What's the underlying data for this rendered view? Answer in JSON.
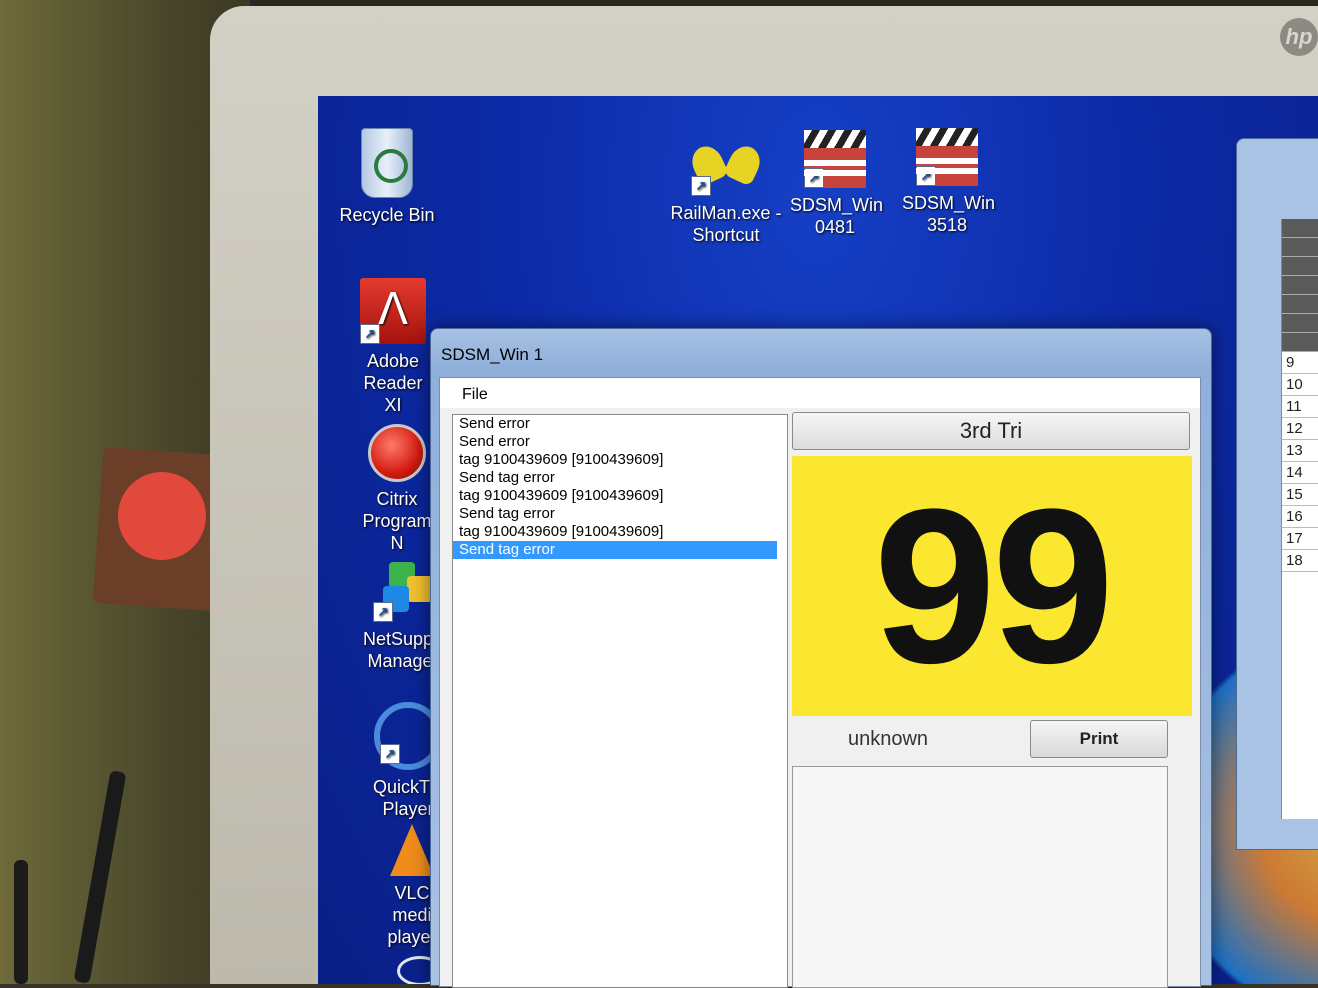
{
  "desktop": {
    "icons": [
      {
        "id": "recycle",
        "label": "Recycle Bin",
        "icon": "recycle-bin-icon"
      },
      {
        "id": "railman",
        "label": "RailMan.exe - Shortcut",
        "icon": "railman-icon"
      },
      {
        "id": "sdsm0481",
        "label": "SDSM_Win 0481",
        "icon": "clapperboard-icon"
      },
      {
        "id": "sdsm3518",
        "label": "SDSM_Win 3518",
        "icon": "clapperboard-icon"
      },
      {
        "id": "adobe",
        "label": "Adobe Reader XI",
        "icon": "adobe-reader-icon"
      },
      {
        "id": "citrix",
        "label": "Citrix Program N",
        "icon": "citrix-icon"
      },
      {
        "id": "netsupport",
        "label": "NetSuppo Manager",
        "icon": "netsupport-icon"
      },
      {
        "id": "quicktime",
        "label": "QuickTim Player",
        "icon": "quicktime-icon"
      },
      {
        "id": "vlc",
        "label": "VLC medi player",
        "icon": "vlc-icon"
      }
    ]
  },
  "window": {
    "title": "SDSM_Win 1",
    "menu": {
      "file": "File"
    },
    "log": [
      "Send error",
      "Send error",
      "tag 9100439609  [9100439609]",
      "Send tag error",
      "tag 9100439609  [9100439609]",
      "Send tag error",
      "tag 9100439609  [9100439609]",
      "Send tag error"
    ],
    "log_selected_index": 7,
    "tri_button": "3rd Tri",
    "big_number": "99",
    "status": "unknown",
    "print_button": "Print"
  },
  "side_window": {
    "rows": [
      "9",
      "10",
      "11",
      "12",
      "13",
      "14",
      "15",
      "16",
      "17",
      "18"
    ]
  },
  "colors": {
    "desktop_blue": "#0c2aa6",
    "highlight": "#fbe72f",
    "selection": "#3399ff"
  }
}
